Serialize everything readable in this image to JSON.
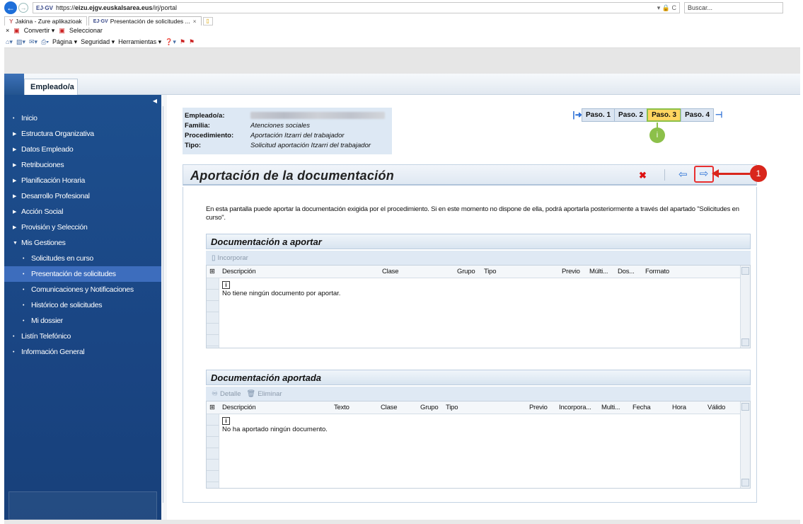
{
  "browser": {
    "url_prefix": "https://",
    "url_domain": "eizu.ejgv.euskalsarea.eus",
    "url_path": "/irj/portal",
    "url_tools": "▾ 🔒 C",
    "search_placeholder": "Buscar...",
    "favicon_text": "EJ·GV",
    "tabs": [
      {
        "label": "Jakina - Zure aplikazioak",
        "icon": "Y"
      },
      {
        "label": "Presentación de solicitudes ...",
        "icon": "EJ·GV",
        "close": "×"
      }
    ],
    "conv_close": "×",
    "convert_label": "Convertir ▾",
    "select_label": "Seleccionar",
    "cmd": {
      "page": "Página ▾",
      "security": "Seguridad ▾",
      "tools": "Herramientas ▾",
      "help": "❓▾"
    }
  },
  "portal": {
    "tab": "Empleado/a"
  },
  "sidebar": {
    "items": [
      {
        "label": "Inicio",
        "marker": "•",
        "sub": false
      },
      {
        "label": "Estructura Organizativa",
        "marker": "▶",
        "sub": false
      },
      {
        "label": "Datos Empleado",
        "marker": "▶",
        "sub": false
      },
      {
        "label": "Retribuciones",
        "marker": "▶",
        "sub": false
      },
      {
        "label": "Planificación Horaria",
        "marker": "▶",
        "sub": false
      },
      {
        "label": "Desarrollo Profesional",
        "marker": "▶",
        "sub": false
      },
      {
        "label": "Acción Social",
        "marker": "▶",
        "sub": false
      },
      {
        "label": "Provisión y Selección",
        "marker": "▶",
        "sub": false
      },
      {
        "label": "Mis Gestiones",
        "marker": "▼",
        "sub": false
      },
      {
        "label": "Solicitudes en curso",
        "marker": "•",
        "sub": true
      },
      {
        "label": "Presentación de solicitudes",
        "marker": "•",
        "sub": true,
        "selected": true
      },
      {
        "label": "Comunicaciones y Notificaciones",
        "marker": "•",
        "sub": true
      },
      {
        "label": "Histórico de solicitudes",
        "marker": "•",
        "sub": true
      },
      {
        "label": "Mi dossier",
        "marker": "•",
        "sub": true
      },
      {
        "label": "Listín Telefónico",
        "marker": "•",
        "sub": false
      },
      {
        "label": "Información General",
        "marker": "•",
        "sub": false
      }
    ]
  },
  "info": {
    "employee_label": "Empleado/a:",
    "family_label": "Familia:",
    "family_value": "Atenciones sociales",
    "procedure_label": "Procedimiento:",
    "procedure_value": "Aportación Itzarri del trabajador",
    "type_label": "Tipo:",
    "type_value": "Solicitud aportación Itzarri del trabajador"
  },
  "steps": {
    "items": [
      "Paso. 1",
      "Paso. 2",
      "Paso. 3",
      "Paso. 4"
    ],
    "active_index": 2,
    "badge": "i"
  },
  "page": {
    "title": "Aportación de la documentación",
    "annotation_number": "1",
    "intro": "En esta pantalla puede aportar la documentación exigida por el procedimiento. Si en este momento no dispone de ella, podrá aportarla posteriormente a través del apartado \"Solicitudes en curso\"."
  },
  "doc_to_provide": {
    "title": "Documentación a aportar",
    "toolbar": {
      "incorporate": "Incorporar"
    },
    "columns": [
      "Descripción",
      "Clase",
      "Grupo",
      "Tipo",
      "Previo",
      "Múlti...",
      "Dos...",
      "Formato"
    ],
    "message": "No tiene ningún documento por aportar.",
    "info_icon": "i"
  },
  "doc_provided": {
    "title": "Documentación aportada",
    "toolbar": {
      "detail": "Detalle",
      "delete": "Eliminar"
    },
    "columns": [
      "Descripción",
      "Texto",
      "Clase",
      "Grupo",
      "Tipo",
      "Previo",
      "Incorpora...",
      "Multi...",
      "Fecha",
      "Hora",
      "Válido"
    ],
    "message": "No ha aportado ningún documento.",
    "info_icon": "i"
  },
  "colors": {
    "sidebar": "#1d4f8e",
    "selected": "#3d6dbd",
    "active_step": "#ffd560",
    "annotation": "#d9261c",
    "step_badge": "#8cc04a"
  }
}
